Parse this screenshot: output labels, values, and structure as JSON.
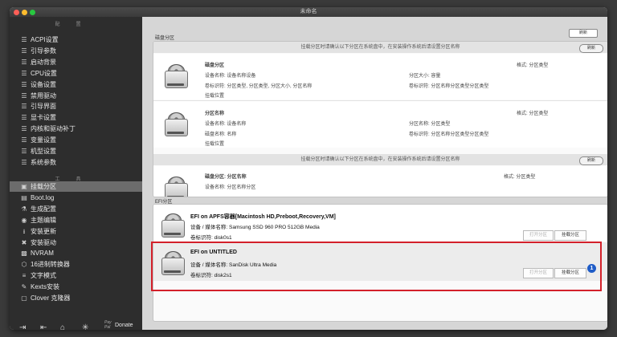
{
  "window": {
    "title": "未命名"
  },
  "sidebar": {
    "section_config": "配置",
    "config_items": [
      {
        "label": "ACPI设置",
        "icon": "list-icon"
      },
      {
        "label": "引导参数",
        "icon": "list-icon"
      },
      {
        "label": "启动背景",
        "icon": "list-icon"
      },
      {
        "label": "CPU设置",
        "icon": "list-icon"
      },
      {
        "label": "设备设置",
        "icon": "list-icon"
      },
      {
        "label": "禁用驱动",
        "icon": "list-icon"
      },
      {
        "label": "引导界面",
        "icon": "list-icon"
      },
      {
        "label": "显卡设置",
        "icon": "list-icon"
      },
      {
        "label": "内核和驱动补丁",
        "icon": "list-icon"
      },
      {
        "label": "变量设置",
        "icon": "list-icon"
      },
      {
        "label": "机型设置",
        "icon": "list-icon"
      },
      {
        "label": "系统参数",
        "icon": "list-icon"
      }
    ],
    "section_tools": "工具",
    "tool_items": [
      {
        "label": "挂载分区",
        "icon": "disk-icon"
      },
      {
        "label": "Boot.log",
        "icon": "log-icon"
      },
      {
        "label": "生成配置",
        "icon": "settings-icon"
      },
      {
        "label": "主题编辑",
        "icon": "theme-icon"
      },
      {
        "label": "安装更新",
        "icon": "install-icon"
      },
      {
        "label": "安装驱动",
        "icon": "tools-icon"
      },
      {
        "label": "NVRAM",
        "icon": "chip-icon"
      },
      {
        "label": "16进制转换器",
        "icon": "hex-icon"
      },
      {
        "label": "文字模式",
        "icon": "text-icon"
      },
      {
        "label": "Kexts安装",
        "icon": "kext-icon"
      },
      {
        "label": "Clover 克隆器",
        "icon": "clone-icon"
      }
    ],
    "donate": {
      "pay": "Pay",
      "pal": "Pal",
      "label": "Donate"
    }
  },
  "main": {
    "top_group_label": "磁盘分区",
    "top_small_button": "刷新",
    "top_panel_header": "挂载分区时请确认以下分区在系统盘中，在安装操作系统后请设置分区名称",
    "top_panel_pill": "刷新",
    "partitions_blurred": [
      {
        "name": "磁盘分区",
        "tag": "格式: 分区类型",
        "line1": "设备名称: 设备名称设备",
        "line2": "卷标识符: 分区类型, 分区类型, 分区大小, 分区名称",
        "line3": "挂载位置",
        "right1": "分区大小: 容量",
        "right2": "卷标识符: 分区名称分区类型分区类型"
      },
      {
        "name": "分区名称",
        "tag": "格式: 分区类型",
        "line1": "设备名称: 设备名称",
        "line2": "磁盘名称: 名称",
        "line3": "挂载位置",
        "right1": "分区名称: 分区类型",
        "right2": "卷标识符: 分区名称分区类型分区类型"
      }
    ],
    "mid_strip": "挂载分区时请确认以下分区在系统盘中，在安装操作系统后请设置分区名称",
    "mid_pill": "刷新",
    "partial": {
      "name": "磁盘分区: 分区名称",
      "tag": "格式: 分区类型",
      "line1": "设备名称: 分区名称分区"
    },
    "efi_group_label": "EFI分区",
    "efi_items": [
      {
        "title": "EFI on APFS容器[Macintosh HD,Preboot,Recovery,VM]",
        "device": "设备 / 媒体名称: Samsung SSD 960 PRO 512GB Media",
        "volume": "卷标识符: disk0s1",
        "open_label": "打开分区",
        "mount_label": "挂载分区"
      },
      {
        "title": "EFI on UNTITLED",
        "device": "设备 / 媒体名称: SanDisk Ultra Media",
        "volume": "卷标识符: disk2s1",
        "open_label": "打开分区",
        "mount_label": "挂载分区"
      }
    ],
    "badge_number": "1"
  },
  "colors": {
    "highlight": "#d3202a",
    "badge": "#1f5cc7"
  }
}
